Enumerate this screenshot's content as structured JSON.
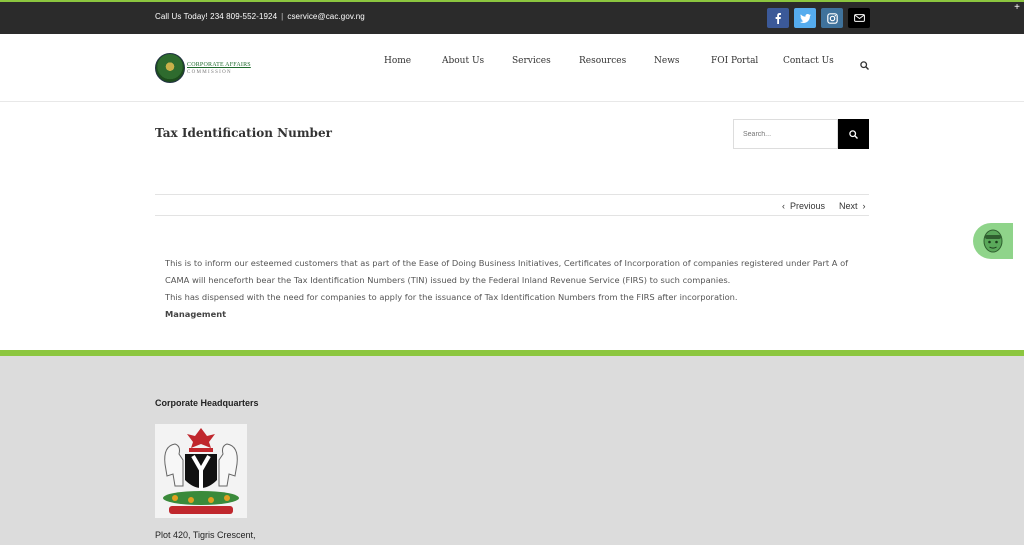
{
  "topbar": {
    "contact_phone": "Call Us Today! 234 809-552-1924",
    "separator": "|",
    "contact_email": "cservice@cac.gov.ng",
    "social_icons": [
      "facebook-icon",
      "twitter-icon",
      "instagram-icon",
      "email-icon"
    ],
    "corner_glyph": "+"
  },
  "header": {
    "logo_text_line1": "CORPORATE AFFAIRS",
    "logo_text_line2": "COMMISSION",
    "nav": [
      {
        "label": "Home"
      },
      {
        "label": "About Us"
      },
      {
        "label": "Services"
      },
      {
        "label": "Resources"
      },
      {
        "label": "News"
      },
      {
        "label": "FOI Portal"
      },
      {
        "label": "Contact Us"
      }
    ]
  },
  "page": {
    "title": "Tax Identification Number",
    "search_placeholder": "Search...",
    "prev_label": "Previous",
    "next_label": "Next"
  },
  "content": {
    "paragraph1": "This is to inform our esteemed customers that as part of the Ease of Doing Business Initiatives,  Certificates of Incorporation of companies registered under Part A of CAMA will henceforth bear the Tax Identification Numbers (TIN) issued by the Federal Inland Revenue Service (FIRS) to such companies.",
    "paragraph2": "This has dispensed with the need for companies to apply for the issuance of Tax Identification Numbers from the FIRS after incorporation.",
    "signoff": "Management"
  },
  "footer": {
    "heading": "Corporate Headquarters",
    "address_line1": "Plot 420, Tigris Crescent,"
  },
  "colors": {
    "accent_green": "#8cc63f",
    "topbar_bg": "#2b2b2b",
    "footer_bg": "#dcdcdc",
    "facebook": "#3b5998",
    "twitter": "#55acee",
    "instagram": "#3f729b"
  }
}
